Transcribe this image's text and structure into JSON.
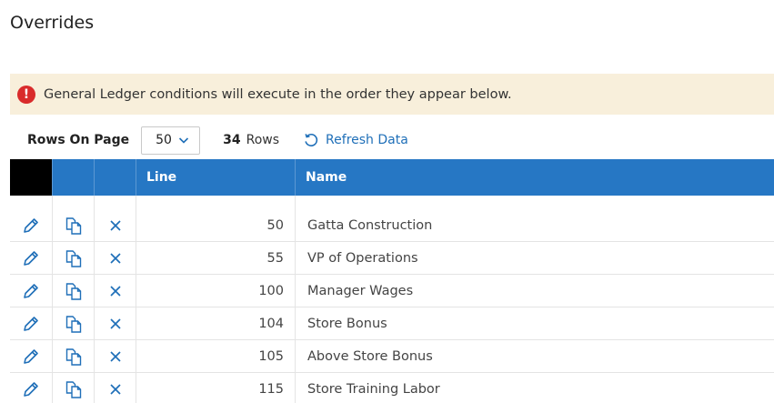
{
  "page": {
    "title": "Overrides"
  },
  "alert": {
    "icon": "exclamation-circle-icon",
    "glyph": "!",
    "text": "General Ledger conditions will execute in the order they appear below."
  },
  "toolbar": {
    "rows_on_page_label": "Rows On Page",
    "rows_on_page_value": "50",
    "row_count": "34",
    "row_count_label": "Rows",
    "refresh_label": "Refresh Data"
  },
  "grid": {
    "columns": [
      "",
      "",
      "",
      "Line",
      "Name"
    ],
    "rows": [
      {
        "line": "50",
        "name": "Gatta Construction"
      },
      {
        "line": "55",
        "name": "VP of Operations"
      },
      {
        "line": "100",
        "name": "Manager Wages"
      },
      {
        "line": "104",
        "name": "Store Bonus"
      },
      {
        "line": "105",
        "name": "Above Store Bonus"
      },
      {
        "line": "115",
        "name": "Store Training Labor"
      }
    ]
  },
  "colors": {
    "accent": "#2677c4",
    "link": "#1f6fb8",
    "alert_bg": "#f8efdb",
    "alert_icon": "#d92b2b"
  }
}
